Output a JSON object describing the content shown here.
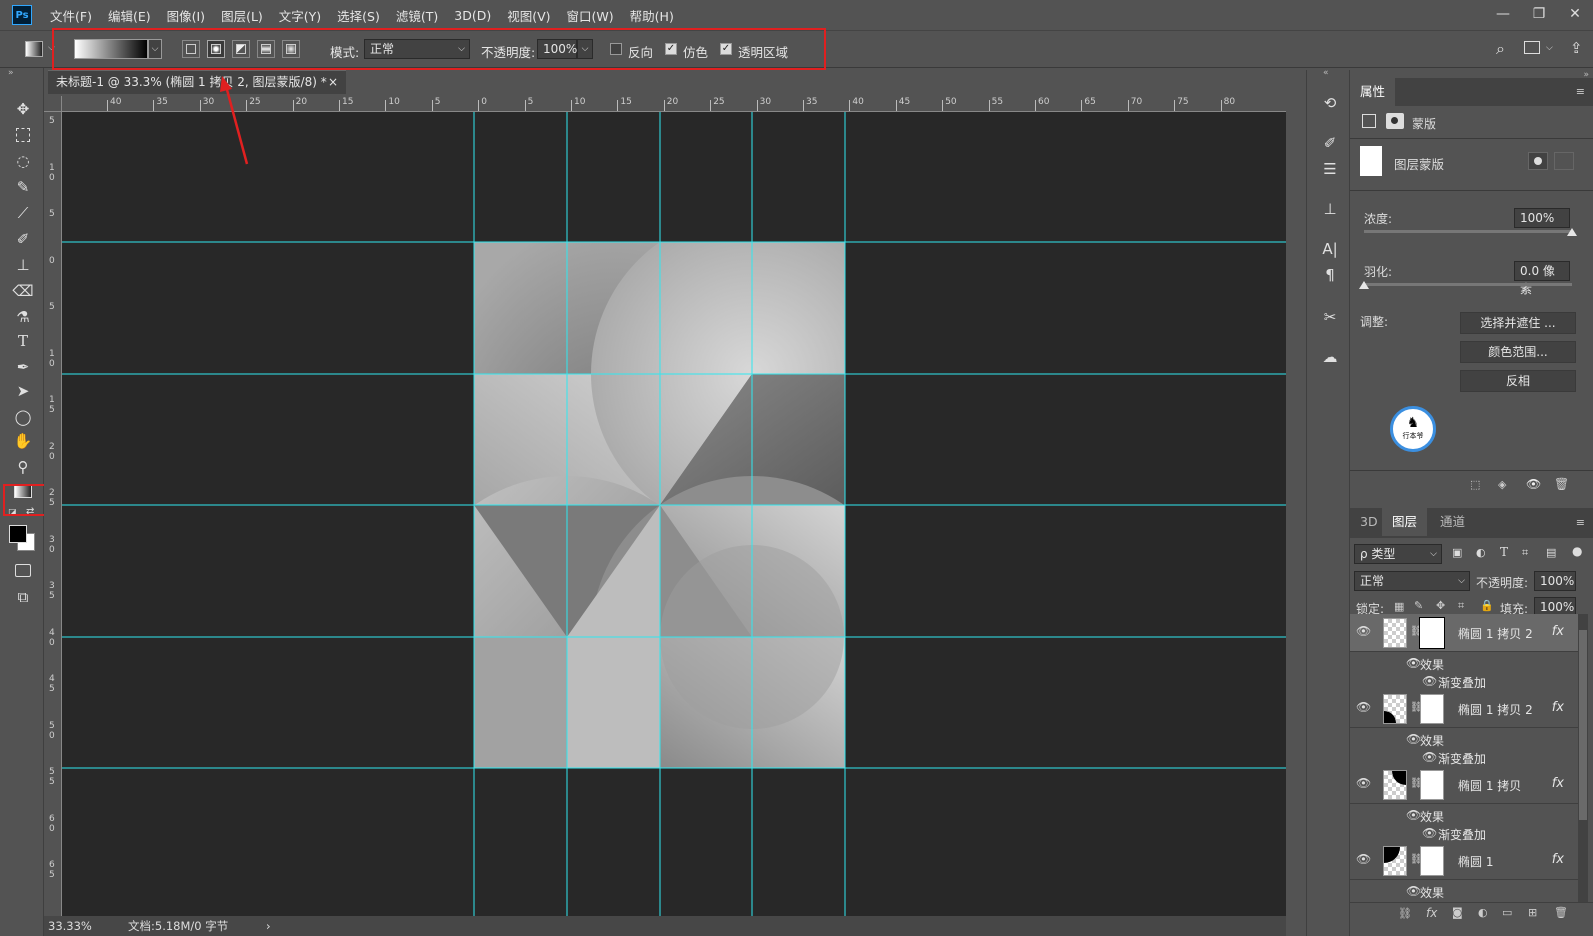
{
  "app": {
    "logo": "Ps"
  },
  "menu": [
    "文件(F)",
    "编辑(E)",
    "图像(I)",
    "图层(L)",
    "文字(Y)",
    "选择(S)",
    "滤镜(T)",
    "3D(D)",
    "视图(V)",
    "窗口(W)",
    "帮助(H)"
  ],
  "window_controls": {
    "minimize": "—",
    "restore": "❐",
    "close": "✕"
  },
  "options": {
    "mode_label": "模式:",
    "mode_value": "正常",
    "opacity_label": "不透明度:",
    "opacity_value": "100%",
    "reverse_label": "反向",
    "reverse_checked": false,
    "dither_label": "仿色",
    "dither_checked": true,
    "transparency_label": "透明区域",
    "transparency_checked": true,
    "gradient_types": [
      "linear",
      "radial",
      "angle",
      "reflected",
      "diamond"
    ],
    "active_gradient_type": "radial"
  },
  "document": {
    "tab_title": "未标题-1 @ 33.3% (椭圆 1 拷贝 2, 图层蒙版/8) *",
    "close_glyph": "×"
  },
  "rulers": {
    "h_labels": [
      "40",
      "35",
      "30",
      "25",
      "20",
      "15",
      "10",
      "5",
      "0",
      "5",
      "10",
      "15",
      "20",
      "25",
      "30",
      "35",
      "40",
      "45",
      "50",
      "55",
      "60",
      "65",
      "70",
      "75",
      "80"
    ],
    "v_labels": [
      "5",
      "1\n0",
      "5",
      "0",
      "5",
      "1\n0",
      "1\n5",
      "2\n0",
      "2\n5",
      "3\n0",
      "3\n5",
      "4\n0",
      "4\n5",
      "5\n0",
      "5\n5",
      "6\n0",
      "6\n5"
    ]
  },
  "status": {
    "zoom": "33.33%",
    "doc_info": "文档:5.18M/0 字节",
    "arrow": "›"
  },
  "properties": {
    "tab": "属性",
    "mask_label": "蒙版",
    "layer_mask_label": "图层蒙版",
    "density_label": "浓度:",
    "density_value": "100%",
    "density_fraction": 1.0,
    "feather_label": "羽化:",
    "feather_value": "0.0 像素",
    "feather_fraction": 0.0,
    "adjust_label": "调整:",
    "btn_select_mask": "选择并遮住 ...",
    "btn_color_range": "颜色范围...",
    "btn_invert": "反相",
    "logo_text": "行本爷"
  },
  "layers_panel": {
    "tabs": [
      "3D",
      "图层",
      "通道"
    ],
    "active_tab": "图层",
    "filter_label": "ρ 类型",
    "blend_mode": "正常",
    "opacity_label": "不透明度:",
    "opacity_value": "100%",
    "lock_label": "锁定:",
    "fill_label": "填充:",
    "fill_value": "100%",
    "layers": [
      {
        "name": "椭圆 1 拷贝 2",
        "selected": true,
        "effects_label": "效果",
        "effect": "渐变叠加"
      },
      {
        "name": "椭圆 1 拷贝 2",
        "selected": false,
        "effects_label": "效果",
        "effect": "渐变叠加"
      },
      {
        "name": "椭圆 1 拷贝",
        "selected": false,
        "effects_label": "效果",
        "effect": "渐变叠加"
      },
      {
        "name": "椭圆 1",
        "selected": false,
        "effects_label": "效果",
        "effect": ""
      }
    ],
    "fx_glyph": "fx"
  },
  "colors": {
    "guide": "#2fe8f0",
    "annotation": "#e02020",
    "canvas_bg": "#282828"
  }
}
